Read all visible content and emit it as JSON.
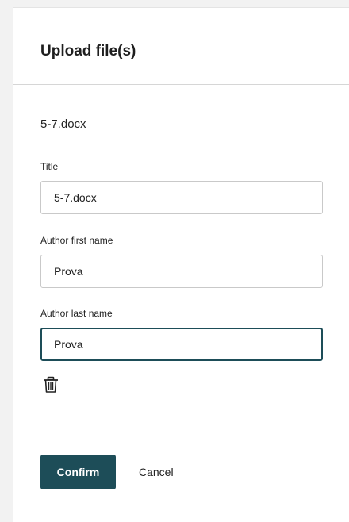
{
  "dialog": {
    "title": "Upload file(s)"
  },
  "file": {
    "name": "5-7.docx",
    "fields": {
      "title": {
        "label": "Title",
        "value": "5-7.docx"
      },
      "author_first_name": {
        "label": "Author first name",
        "value": "Prova"
      },
      "author_last_name": {
        "label": "Author last name",
        "value": "Prova"
      }
    },
    "delete_icon": "trash-icon"
  },
  "actions": {
    "confirm_label": "Confirm",
    "cancel_label": "Cancel"
  },
  "colors": {
    "primary": "#1d4d58",
    "background": "#f2f2f2",
    "panel": "#ffffff",
    "divider": "#d6d6d6"
  }
}
